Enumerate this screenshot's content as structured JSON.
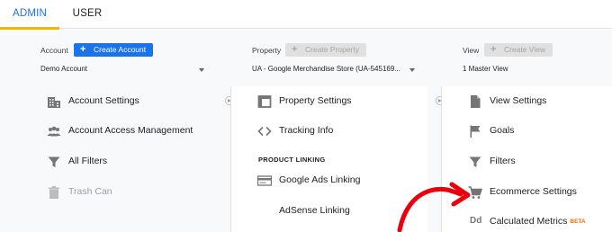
{
  "tabs": {
    "admin": "ADMIN",
    "user": "USER"
  },
  "account": {
    "label": "Account",
    "create_button": "Create Account",
    "selected": "Demo Account",
    "items": [
      "Account Settings",
      "Account Access Management",
      "All Filters",
      "Trash Can"
    ]
  },
  "property": {
    "label": "Property",
    "create_button": "Create Property",
    "selected": "UA - Google Merchandise Store (UA-545169...",
    "items": [
      "Property Settings",
      "Tracking Info"
    ],
    "section_title": "PRODUCT LINKING",
    "linking_items": [
      "Google Ads Linking",
      "AdSense Linking"
    ]
  },
  "view": {
    "label": "View",
    "create_button": "Create View",
    "selected": "1 Master View",
    "items": [
      "View Settings",
      "Goals",
      "Filters",
      "Ecommerce Settings",
      "Calculated Metrics"
    ],
    "beta_badge": "BETA",
    "calculated_metrics_icon_text": "Dd"
  },
  "colors": {
    "accent": "#1a73e8",
    "tab_underline": "#f4b400",
    "annotation_arrow": "#e8000b",
    "icon_gray": "#757575"
  },
  "icons": {
    "account_settings": "building-icon",
    "access_management": "people-icon",
    "filters": "funnel-icon",
    "trash": "trash-can-icon",
    "property_settings": "window-icon",
    "tracking": "code-brackets-icon",
    "google_ads": "card-icon",
    "view_settings": "document-icon",
    "goals": "flag-icon",
    "ecommerce": "cart-icon"
  }
}
